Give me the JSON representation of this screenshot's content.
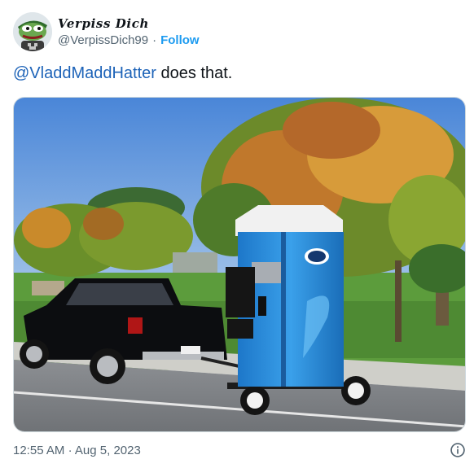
{
  "author": {
    "display_name": "Verpiss Dich",
    "handle": "@VerpissDich99",
    "separator": "·",
    "follow_label": "Follow",
    "avatar_icon": "frog-avatar"
  },
  "tweet": {
    "mention": "@VladdMaddHatter",
    "text": " does that."
  },
  "media": {
    "description_icon": "photo-truck-towing-portable-toilet"
  },
  "footer": {
    "time": "12:55 AM",
    "separator": "·",
    "date": "Aug 5, 2023",
    "info_icon": "info-icon"
  },
  "colors": {
    "link": "#1d9bf0",
    "mention": "#1d63b8",
    "secondary_text": "#536471"
  }
}
